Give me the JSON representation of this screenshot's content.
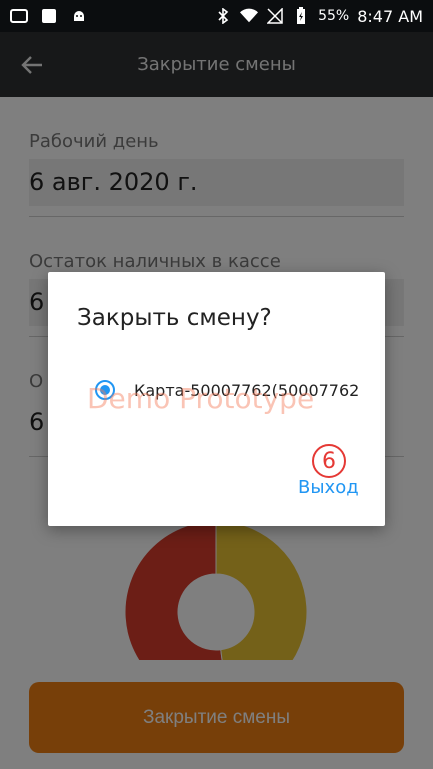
{
  "status_bar": {
    "battery_percent": "55%",
    "time": "8:47 AM"
  },
  "app_bar": {
    "title": "Закрытие смены"
  },
  "form": {
    "work_day_label": "Рабочий день",
    "work_day_value": "6 авг. 2020 г.",
    "cash_rest_label": "Остаток наличных в кассе",
    "cash_rest_value": "6",
    "third_label": "О",
    "third_value": "6"
  },
  "chart_data": {
    "type": "pie",
    "categories": [
      "",
      ""
    ],
    "values": [
      52,
      48
    ],
    "colors": [
      "#d93c2c",
      "#e9c233"
    ],
    "title": "",
    "legend": "none"
  },
  "bottom": {
    "close_shift_label": "Закрытие смены"
  },
  "dialog": {
    "title": "Закрыть смену?",
    "option_label": "Карта-50007762(50007762)",
    "watermark": "Demo Prototype",
    "step_number": "6",
    "exit_label": "Выход"
  },
  "colors": {
    "accent": "#2196f3",
    "primary_button": "#ef7e12",
    "app_bar": "#2e3133",
    "status_bar": "#0b0d0f"
  },
  "icons": {
    "back": "arrow-left-icon",
    "bluetooth": "bluetooth-icon",
    "wifi": "wifi-icon",
    "battery": "battery-charging-icon"
  }
}
